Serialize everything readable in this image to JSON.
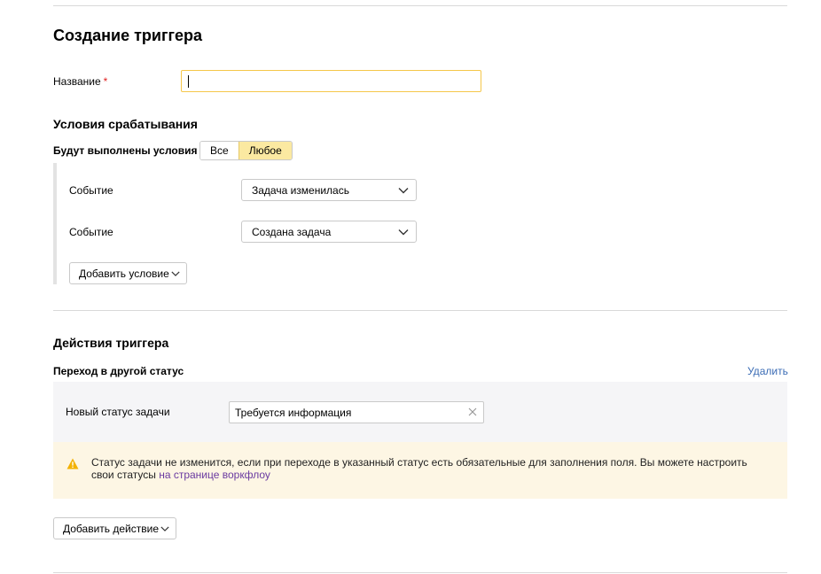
{
  "page": {
    "title": "Создание триггера"
  },
  "name_field": {
    "label": "Название",
    "required_mark": "*",
    "value": ""
  },
  "conditions": {
    "title": "Условия срабатывания",
    "match_label": "Будут выполнены условия",
    "match_options": [
      "Все",
      "Любое"
    ],
    "match_selected": "Любое",
    "items": [
      {
        "label": "Событие",
        "value": "Задача изменилась"
      },
      {
        "label": "Событие",
        "value": "Создана задача"
      }
    ],
    "add_button": "Добавить условие"
  },
  "actions": {
    "title": "Действия триггера",
    "action": {
      "title": "Переход в другой статус",
      "delete_label": "Удалить",
      "status_label": "Новый статус задачи",
      "status_value": "Требуется информация"
    },
    "warning": {
      "text": "Статус задачи не изменится, если при переходе в указанный статус есть обязательные для заполнения поля. Вы можете настроить свои статусы ",
      "link": "на странице воркфлоу",
      "icon": "warning-icon",
      "color": "#f3b100"
    },
    "add_button": "Добавить действие"
  },
  "colors": {
    "accent_yellow": "#fbe9a1",
    "focus_border": "#f5c74a",
    "link_blue": "#3b6cb5",
    "warning_bg": "#fdf6e4"
  }
}
